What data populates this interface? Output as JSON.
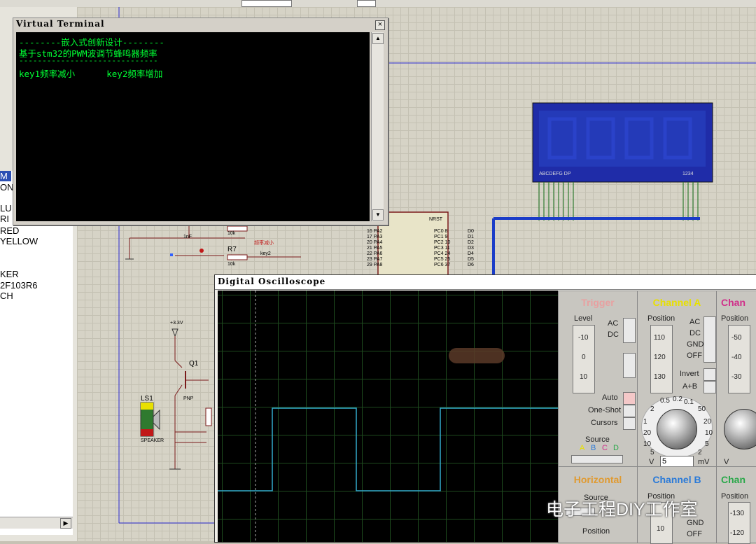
{
  "left_panel": {
    "items": [
      "M",
      "ON",
      "LU",
      "RI",
      "RED",
      "YELLOW",
      "KER",
      "2F103R6",
      "CH"
    ]
  },
  "virtual_terminal": {
    "title": "Virtual Terminal",
    "close_label": "×",
    "lines": [
      "--------嵌入式创新设计--------",
      "基于stm32的PWM波调节蜂鸣器频率",
      "------------------------------",
      "key1频率减小      key2频率增加"
    ]
  },
  "schematic": {
    "lcd_left_label": "ABCDEFG  DP",
    "lcd_right_label": "1234",
    "cap_label": "1nF",
    "r6_value": "10k",
    "r7_label": "R7",
    "r7_value": "10k",
    "key2_label": "key2",
    "freq_dec_label": "频率减小",
    "supply_label": "+3.3V",
    "q1_label": "Q1",
    "pnp_label": "PNP",
    "ls1_label": "LS1",
    "speaker_label": "SPEAKER",
    "mcu_pins_left": [
      "PA2",
      "PA3",
      "PA4",
      "PA5",
      "PA6",
      "PA7",
      "PA8"
    ],
    "mcu_pin_nums_left": [
      "16",
      "17",
      "20",
      "21",
      "22",
      "23",
      "29"
    ],
    "mcu_nrst": "NRST",
    "mcu_pins_right": [
      "PC0",
      "PC1",
      "PC2",
      "PC3",
      "PC4",
      "PC5",
      "PC6"
    ],
    "mcu_pin_nums_right": [
      "8",
      "9",
      "10",
      "11",
      "24",
      "25",
      "37"
    ],
    "bus_labels": [
      "D0",
      "D1",
      "D2",
      "D3",
      "D4",
      "D5",
      "D6"
    ]
  },
  "oscilloscope": {
    "title": "Digital Oscilloscope",
    "trigger": {
      "heading": "Trigger",
      "level_label": "Level",
      "level_ticks": [
        "-10",
        "0",
        "10"
      ],
      "ac": "AC",
      "dc": "DC",
      "auto": "Auto",
      "one_shot": "One-Shot",
      "cursors": "Cursors",
      "source_label": "Source",
      "sources": [
        "A",
        "B",
        "C",
        "D"
      ]
    },
    "channel_a": {
      "heading": "Channel A",
      "position_label": "Position",
      "position_ticks": [
        "110",
        "120",
        "130"
      ],
      "coupling": [
        "AC",
        "DC",
        "GND",
        "OFF"
      ],
      "invert": "Invert",
      "a_plus_b": "A+B",
      "dial_ticks": [
        "0.5",
        "0.2",
        "0.1",
        "50",
        "20",
        "10",
        "5",
        "2",
        "1",
        "20",
        "10",
        "5",
        "2"
      ],
      "volts_value": "5",
      "unit_v": "V",
      "unit_mv": "mV"
    },
    "channel_c": {
      "heading": "Chan",
      "position_label": "Position",
      "position_ticks": [
        "-50",
        "-40",
        "-30"
      ],
      "volts_unit": "V"
    },
    "horizontal": {
      "heading": "Horizontal",
      "source_label": "Source",
      "position_label": "Position"
    },
    "channel_b": {
      "heading": "Channel B",
      "position_label": "Position",
      "position_tick": "10",
      "coupling": [
        "GND",
        "OFF"
      ]
    },
    "channel_d": {
      "heading": "Chan",
      "position_label": "Position",
      "position_ticks": [
        "-130",
        "-120"
      ]
    },
    "waveform": {
      "levels": [
        "high",
        "low"
      ],
      "transitions_x_div": [
        -0.2,
        1.8,
        4.8,
        7.8
      ],
      "color": "#33aacc"
    }
  },
  "watermark": "电子工程DIY工作室",
  "colors": {
    "terminal_text": "#00ff33",
    "bus_wire": "#1a3cc8",
    "lcd": "#1f2ca8",
    "trace": "#33aacc",
    "trigger_heading": "#e8a0a0",
    "channel_a_heading": "#e8e000",
    "channel_c_heading": "#d0308a",
    "horizontal_heading": "#e09a30",
    "channel_b_heading": "#2a7ad8",
    "channel_d_heading": "#2aa84a"
  }
}
